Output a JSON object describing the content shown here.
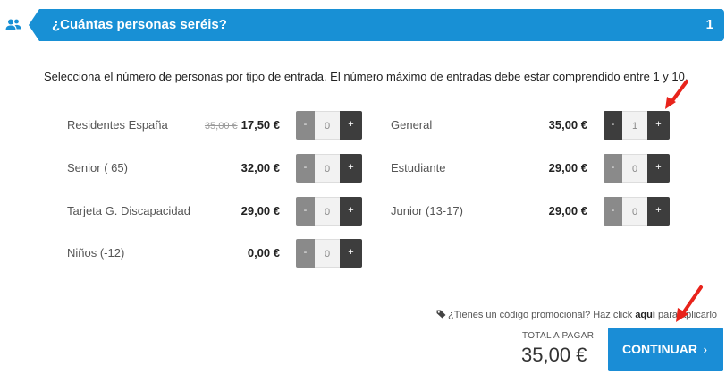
{
  "header": {
    "title": "¿Cuántas personas seréis?",
    "step": "1",
    "color": "#1890d5"
  },
  "instructions": "Selecciona el número de personas por tipo de entrada. El número máximo de entradas debe estar comprendido entre 1 y 10.",
  "tickets_left": [
    {
      "name": "Residentes España",
      "old_price": "35,00 €",
      "price": "17,50 €",
      "quantity": "0"
    },
    {
      "name": "Senior ( 65)",
      "price": "32,00 €",
      "quantity": "0"
    },
    {
      "name": "Tarjeta G. Discapacidad",
      "price": "29,00 €",
      "quantity": "0"
    },
    {
      "name": "Niños (-12)",
      "price": "0,00 €",
      "quantity": "0"
    }
  ],
  "tickets_right": [
    {
      "name": "General",
      "price": "35,00 €",
      "quantity": "1"
    },
    {
      "name": "Estudiante",
      "price": "29,00 €",
      "quantity": "0"
    },
    {
      "name": "Junior (13-17)",
      "price": "29,00 €",
      "quantity": "0"
    }
  ],
  "stepper": {
    "minus_label": "-",
    "plus_label": "+"
  },
  "promo": {
    "text_before": "¿Tienes un código promocional? Haz click ",
    "link": "aquí",
    "text_after": " para aplicarlo"
  },
  "total": {
    "label": "TOTAL A PAGAR",
    "amount": "35,00 €"
  },
  "continue_button": {
    "label": "CONTINUAR",
    "chevron": "›",
    "color": "#1a8dd6"
  },
  "annotation_color": "#e8231b"
}
